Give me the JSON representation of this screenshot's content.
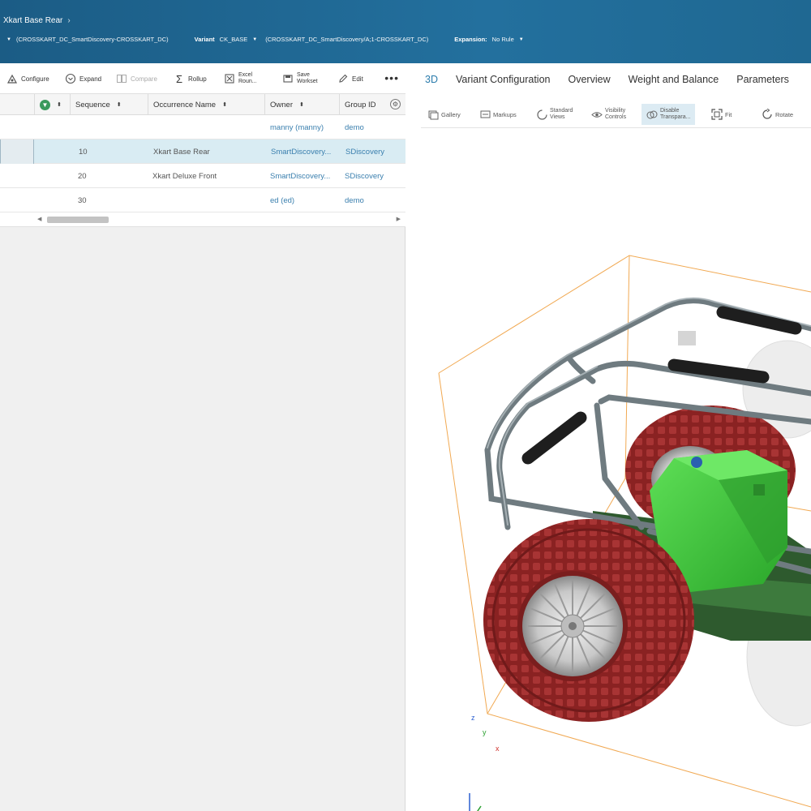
{
  "header": {
    "breadcrumb": "Xkart Base Rear",
    "revision_rule_value": "(CROSSKART_DC_SmartDiscovery-CROSSKART_DC)",
    "variant_label": "Variant",
    "variant_value": "CK_BASE",
    "variant_path": "(CROSSKART_DC_SmartDiscovery/A;1-CROSSKART_DC)",
    "expansion_label": "Expansion:",
    "expansion_value": "No Rule"
  },
  "toolbar": {
    "configure": "Configure",
    "expand": "Expand",
    "compare": "Compare",
    "rollup": "Rollup",
    "excel_line1": "Excel",
    "excel_line2": "Roun...",
    "save_line1": "Save",
    "save_line2": "Workset",
    "edit": "Edit"
  },
  "grid": {
    "columns": {
      "sequence": "Sequence",
      "occurrence_name": "Occurrence Name",
      "owner": "Owner",
      "group_id": "Group ID"
    },
    "rows": [
      {
        "sequence": "",
        "occurrence_name": "",
        "owner": "manny (manny)",
        "group_id": "demo",
        "selected": false
      },
      {
        "sequence": "10",
        "occurrence_name": "Xkart Base Rear",
        "owner": "SmartDiscovery...",
        "group_id": "SDiscovery",
        "selected": true
      },
      {
        "sequence": "20",
        "occurrence_name": "Xkart Deluxe Front",
        "owner": "SmartDiscovery...",
        "group_id": "SDiscovery",
        "selected": false
      },
      {
        "sequence": "30",
        "occurrence_name": "",
        "owner": "ed (ed)",
        "group_id": "demo",
        "selected": false
      }
    ]
  },
  "tabs": [
    "3D",
    "Variant Configuration",
    "Overview",
    "Weight and Balance",
    "Parameters"
  ],
  "viewer_toolbar": {
    "gallery": "Gallery",
    "markups": "Markups",
    "standard_views_1": "Standard",
    "standard_views_2": "Views",
    "visibility_1": "Visibility",
    "visibility_2": "Controls",
    "disable_1": "Disable",
    "disable_2": "Transpara...",
    "fit": "Fit",
    "rotate": "Rotate"
  },
  "axes": {
    "z": "z",
    "y": "y",
    "x": "x"
  },
  "colors": {
    "header": "#1f6892",
    "accent": "#2b7cac",
    "selected_row": "#d9ecf3",
    "tire": "#8b2323",
    "body": "#3ec43a",
    "frame": "#6f7b80",
    "bbox": "#f0a040"
  }
}
